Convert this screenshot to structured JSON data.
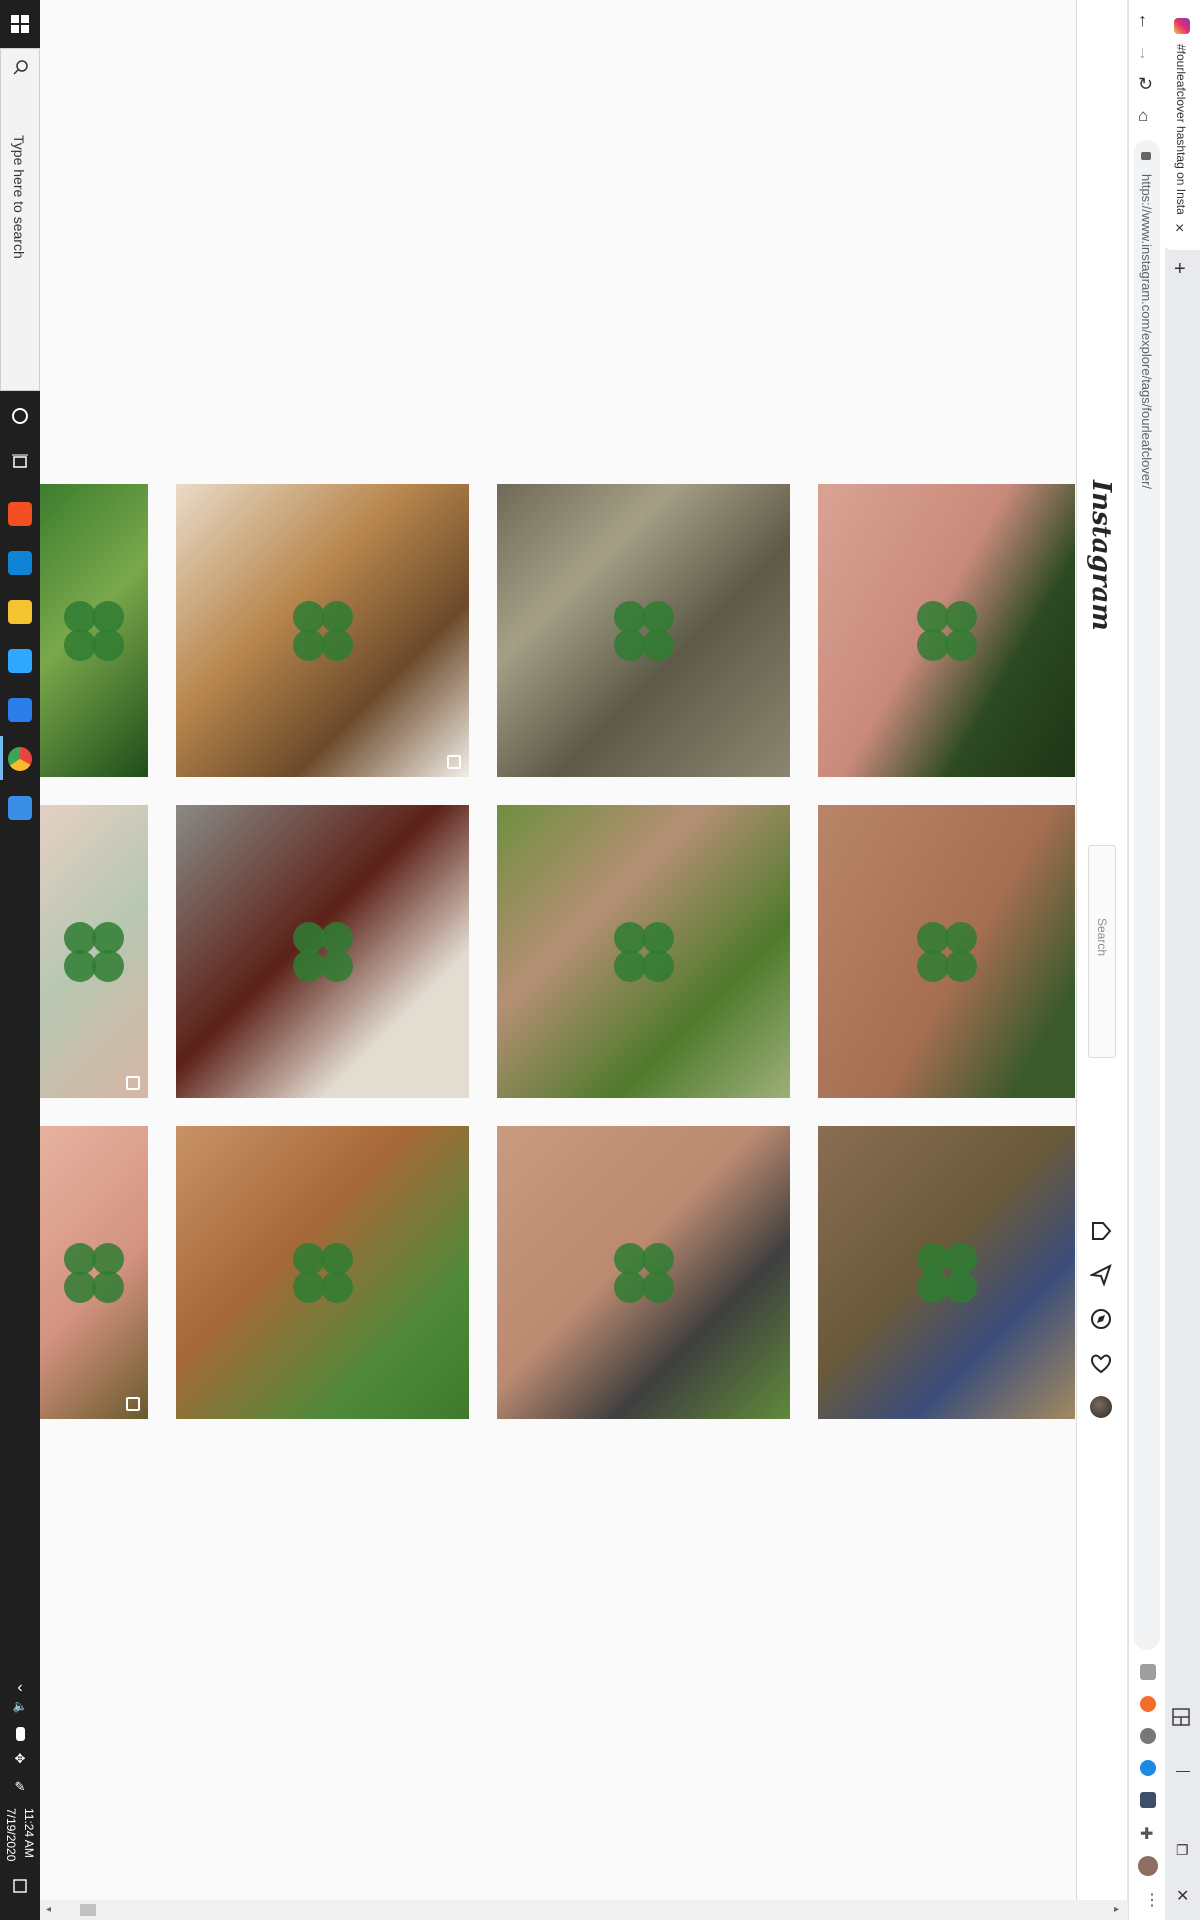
{
  "taskbar": {
    "search_placeholder": "Type here to search",
    "time": "11:24 AM",
    "date": "7/19/2020",
    "apps": [
      {
        "icon": "microsoft-store-icon",
        "color": "#f25022"
      },
      {
        "icon": "edge-icon",
        "color": "#0f84d7"
      },
      {
        "icon": "file-explorer-icon",
        "color": "#f4c430"
      },
      {
        "icon": "photoshop-icon",
        "color": "#31a8ff"
      },
      {
        "icon": "visual-studio-code-icon",
        "color": "#2b7de9"
      },
      {
        "icon": "chrome-icon",
        "color": "#e8453c"
      },
      {
        "icon": "settings-icon",
        "color": "#3a8ee6"
      }
    ]
  },
  "browser": {
    "tab_title": "#fourleafclover hashtag on Insta",
    "tab_close": "×",
    "new_tab": "+",
    "url": "https://www.instagram.com/explore/tags/fourleafclover/",
    "window_buttons": {
      "minimize": "—",
      "maximize": "❐",
      "close": "✕"
    }
  },
  "instagram": {
    "logo": "Instagram",
    "search_placeholder": "Search",
    "nav_icons": [
      "home-icon",
      "direct-icon",
      "explore-icon",
      "activity-heart-icon",
      "profile-avatar"
    ]
  },
  "grid": {
    "tiles": [
      {
        "row": 0,
        "col": 0,
        "theme": "green",
        "multi": false
      },
      {
        "row": 0,
        "col": 1,
        "theme": "dog",
        "multi": true
      },
      {
        "row": 0,
        "col": 2,
        "theme": "straw",
        "multi": false
      },
      {
        "row": 0,
        "col": 3,
        "theme": "hand-dark",
        "multi": false
      },
      {
        "row": 1,
        "col": 0,
        "theme": "hand-glass",
        "multi": true
      },
      {
        "row": 1,
        "col": 1,
        "theme": "crystal-ball",
        "multi": false
      },
      {
        "row": 1,
        "col": 2,
        "theme": "hand-grass",
        "multi": false
      },
      {
        "row": 1,
        "col": 3,
        "theme": "bracelet",
        "multi": false
      },
      {
        "row": 2,
        "col": 0,
        "theme": "hand-soil",
        "multi": true
      },
      {
        "row": 2,
        "col": 1,
        "theme": "dog-grass",
        "multi": false
      },
      {
        "row": 2,
        "col": 2,
        "theme": "freckled-hand",
        "multi": false
      },
      {
        "row": 2,
        "col": 3,
        "theme": "shoes-dirt",
        "multi": false
      }
    ]
  },
  "colors": {
    "taskbar": "#1f1f1f",
    "page_bg": "#fafafa",
    "clover_green": "#2f7d32"
  }
}
